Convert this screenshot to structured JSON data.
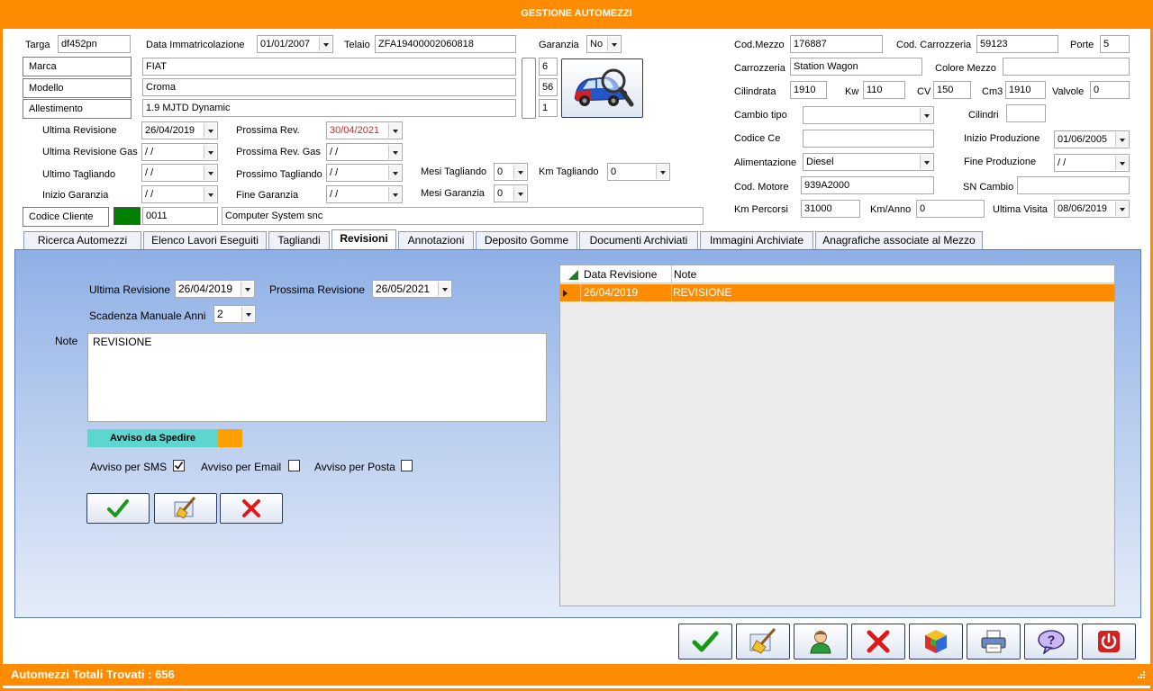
{
  "window": {
    "title": "GESTIONE AUTOMEZZI"
  },
  "vehicle": {
    "targa_label": "Targa",
    "targa": "df452pn",
    "data_imm_label": "Data Immatricolazione",
    "data_imm": "01/01/2007",
    "telaio_label": "Telaio",
    "telaio": "ZFA19400002060818",
    "garanzia_label": "Garanzia",
    "garanzia": "No",
    "marca_label": "Marca",
    "marca": "FIAT",
    "marca_code": "6",
    "modello_label": "Modello",
    "modello": "Croma",
    "modello_code": "56",
    "allestimento_label": "Allestimento",
    "allestimento": "1.9 MJTD Dynamic",
    "allestimento_code": "1",
    "ultima_rev_label": "Ultima Revisione",
    "ultima_rev": "26/04/2019",
    "prossima_rev_label": "Prossima Rev.",
    "prossima_rev": "30/04/2021",
    "ultima_rev_gas_label": "Ultima Revisione Gas",
    "ultima_rev_gas": " /  /",
    "prossima_rev_gas_label": "Prossima Rev. Gas",
    "prossima_rev_gas": " /  /",
    "ultimo_tagl_label": "Ultimo Tagliando",
    "ultimo_tagl": " /  /",
    "prossimo_tagl_label": "Prossimo Tagliando",
    "prossimo_tagl": " /  /",
    "mesi_tagl_label": "Mesi Tagliando",
    "mesi_tagl": "0",
    "km_tagl_label": "Km Tagliando",
    "km_tagl": "0",
    "inizio_gar_label": "Inizio Garanzia",
    "inizio_gar": " /  /",
    "fine_gar_label": "Fine Garanzia",
    "fine_gar": " /  /",
    "mesi_gar_label": "Mesi Garanzia",
    "mesi_gar": "0",
    "codice_cliente_label": "Codice Cliente",
    "codice_cliente": "0011",
    "cliente_nome": "Computer System snc",
    "cod_mezzo_label": "Cod.Mezzo",
    "cod_mezzo": "176887",
    "cod_carrozzeria_label": "Cod. Carrozzeria",
    "cod_carrozzeria": "59123",
    "porte_label": "Porte",
    "porte": "5",
    "carrozzeria_label": "Carrozzeria",
    "carrozzeria": "Station Wagon",
    "colore_label": "Colore Mezzo",
    "colore": "",
    "cilindrata_label": "Cilindrata",
    "cilindrata": "1910",
    "kw_label": "Kw",
    "kw": "110",
    "cv_label": "CV",
    "cv": "150",
    "cm3_label": "Cm3",
    "cm3": "1910",
    "valvole_label": "Valvole",
    "valvole": "0",
    "cambio_label": "Cambio tipo",
    "cambio": "",
    "cilindri_label": "Cilindri",
    "cilindri": "",
    "codice_ce_label": "Codice Ce",
    "codice_ce": "",
    "inizio_prod_label": "Inizio Produzione",
    "inizio_prod": "01/06/2005",
    "alimentazione_label": "Alimentazione",
    "alimentazione": "Diesel",
    "fine_prod_label": "Fine Produzione",
    "fine_prod": " /  /",
    "cod_motore_label": "Cod. Motore",
    "cod_motore": "939A2000",
    "sn_cambio_label": "SN Cambio",
    "sn_cambio": "",
    "km_percorsi_label": "Km Percorsi",
    "km_percorsi": "31000",
    "km_anno_label": "Km/Anno",
    "km_anno": "0",
    "ultima_visita_label": "Ultima Visita",
    "ultima_visita": "08/06/2019"
  },
  "tabs": [
    {
      "label": "Ricerca Automezzi"
    },
    {
      "label": "Elenco Lavori Eseguiti"
    },
    {
      "label": "Tagliandi"
    },
    {
      "label": "Revisioni"
    },
    {
      "label": "Annotazioni"
    },
    {
      "label": "Deposito Gomme"
    },
    {
      "label": "Documenti Archiviati"
    },
    {
      "label": "Immagini Archiviate"
    },
    {
      "label": "Anagrafiche associate al Mezzo"
    }
  ],
  "revisioni": {
    "ultima_label": "Ultima Revisione",
    "ultima": "26/04/2019",
    "prossima_label": "Prossima Revisione",
    "prossima": "26/05/2021",
    "scadenza_label": "Scadenza Manuale Anni",
    "scadenza": "2",
    "note_label": "Note",
    "note": "REVISIONE",
    "avviso_label": "Avviso da Spedire",
    "sms_label": "Avviso per SMS",
    "email_label": "Avviso per Email",
    "posta_label": "Avviso per Posta",
    "sms_checked": true,
    "email_checked": false,
    "posta_checked": false
  },
  "grid": {
    "columns": [
      "Data Revisione",
      "Note"
    ],
    "rows": [
      [
        "26/04/2019",
        "REVISIONE"
      ]
    ]
  },
  "status": {
    "text": "Automezzi Totali Trovati : 656"
  },
  "colors": {
    "accent": "#ff8c00",
    "client_swatch": "#008000",
    "avviso_bar": "#5ed6d0",
    "avviso_swatch": "#ff9f00",
    "date_red": "#e02020"
  },
  "icons": [
    "check-icon",
    "broom-icon",
    "user-icon",
    "delete-icon",
    "cube-icon",
    "printer-icon",
    "help-icon",
    "power-icon",
    "car-search-icon"
  ]
}
